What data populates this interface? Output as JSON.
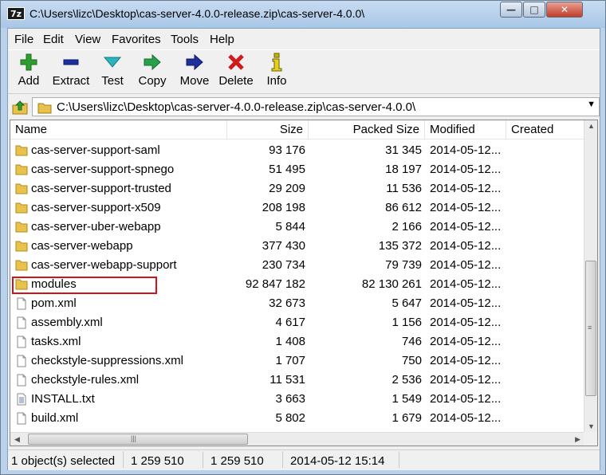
{
  "window": {
    "title": "C:\\Users\\lizc\\Desktop\\cas-server-4.0.0-release.zip\\cas-server-4.0.0\\",
    "app_icon_text": "7z"
  },
  "menu": {
    "items": [
      {
        "label": "File"
      },
      {
        "label": "Edit"
      },
      {
        "label": "View"
      },
      {
        "label": "Favorites"
      },
      {
        "label": "Tools"
      },
      {
        "label": "Help"
      }
    ]
  },
  "toolbar": {
    "buttons": [
      {
        "label": "Add",
        "icon": "plus-icon",
        "color": "#2e9e2e"
      },
      {
        "label": "Extract",
        "icon": "minus-icon",
        "color": "#1c2f9c"
      },
      {
        "label": "Test",
        "icon": "check-icon",
        "color": "#2bb3c0"
      },
      {
        "label": "Copy",
        "icon": "copy-arrow-icon",
        "color": "#27a24a"
      },
      {
        "label": "Move",
        "icon": "move-arrow-icon",
        "color": "#1c2f9c"
      },
      {
        "label": "Delete",
        "icon": "x-icon",
        "color": "#d11b1b"
      },
      {
        "label": "Info",
        "icon": "info-icon",
        "color": "#c8b300"
      }
    ]
  },
  "address": {
    "value": "C:\\Users\\lizc\\Desktop\\cas-server-4.0.0-release.zip\\cas-server-4.0.0\\"
  },
  "columns": {
    "name": "Name",
    "size": "Size",
    "packed": "Packed Size",
    "modified": "Modified",
    "created": "Created"
  },
  "files": [
    {
      "name": "cas-server-support-saml",
      "type": "folder",
      "size": "93 176",
      "packed": "31 345",
      "modified": "2014-05-12..."
    },
    {
      "name": "cas-server-support-spnego",
      "type": "folder",
      "size": "51 495",
      "packed": "18 197",
      "modified": "2014-05-12..."
    },
    {
      "name": "cas-server-support-trusted",
      "type": "folder",
      "size": "29 209",
      "packed": "11 536",
      "modified": "2014-05-12..."
    },
    {
      "name": "cas-server-support-x509",
      "type": "folder",
      "size": "208 198",
      "packed": "86 612",
      "modified": "2014-05-12..."
    },
    {
      "name": "cas-server-uber-webapp",
      "type": "folder",
      "size": "5 844",
      "packed": "2 166",
      "modified": "2014-05-12..."
    },
    {
      "name": "cas-server-webapp",
      "type": "folder",
      "size": "377 430",
      "packed": "135 372",
      "modified": "2014-05-12..."
    },
    {
      "name": "cas-server-webapp-support",
      "type": "folder",
      "size": "230 734",
      "packed": "79 739",
      "modified": "2014-05-12..."
    },
    {
      "name": "modules",
      "type": "folder",
      "size": "92 847 182",
      "packed": "82 130 261",
      "modified": "2014-05-12...",
      "highlighted": true
    },
    {
      "name": "pom.xml",
      "type": "file",
      "size": "32 673",
      "packed": "5 647",
      "modified": "2014-05-12..."
    },
    {
      "name": "assembly.xml",
      "type": "file",
      "size": "4 617",
      "packed": "1 156",
      "modified": "2014-05-12..."
    },
    {
      "name": "tasks.xml",
      "type": "file",
      "size": "1 408",
      "packed": "746",
      "modified": "2014-05-12..."
    },
    {
      "name": "checkstyle-suppressions.xml",
      "type": "file",
      "size": "1 707",
      "packed": "750",
      "modified": "2014-05-12..."
    },
    {
      "name": "checkstyle-rules.xml",
      "type": "file",
      "size": "11 531",
      "packed": "2 536",
      "modified": "2014-05-12..."
    },
    {
      "name": "INSTALL.txt",
      "type": "text",
      "size": "3 663",
      "packed": "1 549",
      "modified": "2014-05-12..."
    },
    {
      "name": "build.xml",
      "type": "file",
      "size": "5 802",
      "packed": "1 679",
      "modified": "2014-05-12..."
    }
  ],
  "status": {
    "selected": "1 object(s) selected",
    "size": "1 259 510",
    "packed": "1 259 510",
    "modified": "2014-05-12 15:14"
  }
}
